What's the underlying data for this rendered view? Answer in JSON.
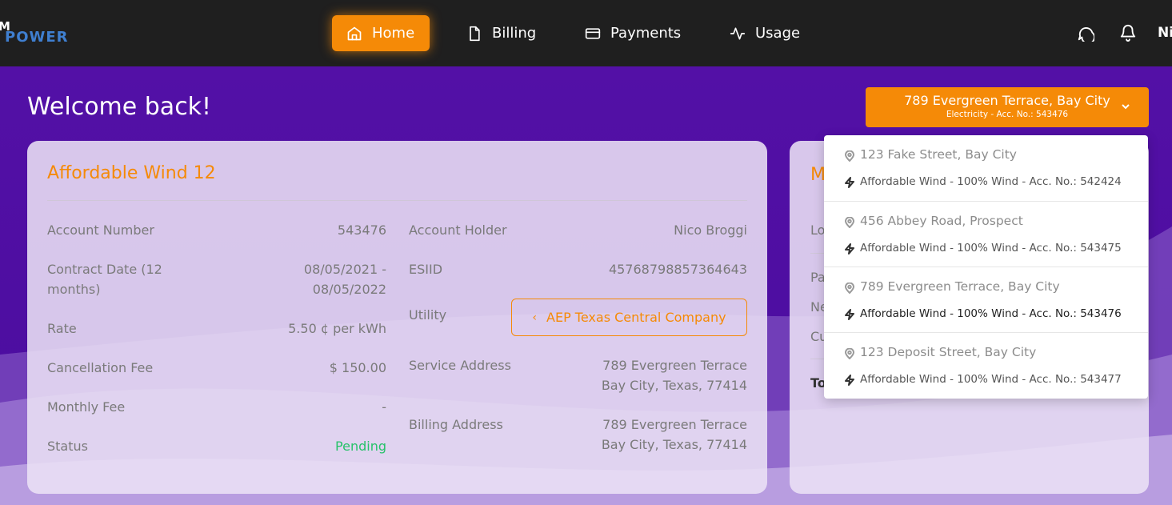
{
  "brand": {
    "mark": "M",
    "name": "POWER"
  },
  "nav": {
    "home": "Home",
    "billing": "Billing",
    "payments": "Payments",
    "usage": "Usage"
  },
  "user": {
    "name": "Ni"
  },
  "welcome": "Welcome back!",
  "account_selector": {
    "address": "789 Evergreen Terrace, Bay City",
    "subtitle": "Electricity - Acc. No.: 543476"
  },
  "plan_card": {
    "title": "Affordable Wind 12",
    "left": {
      "account_number_label": "Account Number",
      "account_number_value": "543476",
      "contract_date_label_1": "Contract Date (12",
      "contract_date_label_2": "months)",
      "contract_date_value_1": "08/05/2021 -",
      "contract_date_value_2": "08/05/2022",
      "rate_label": "Rate",
      "rate_value": "5.50 ¢ per kWh",
      "cancellation_fee_label": "Cancellation Fee",
      "cancellation_fee_value": "$ 150.00",
      "monthly_fee_label": "Monthly Fee",
      "monthly_fee_value": "-",
      "status_label": "Status",
      "status_value": "Pending"
    },
    "right": {
      "account_holder_label": "Account Holder",
      "account_holder_value": "Nico Broggi",
      "esiid_label": "ESIID",
      "esiid_value": "45768798857364643",
      "utility_label": "Utility",
      "utility_value": "AEP Texas Central Company",
      "service_address_label": "Service Address",
      "service_address_line1": "789 Evergreen Terrace",
      "service_address_line2": "Bay City, Texas, 77414",
      "billing_address_label": "Billing Address",
      "billing_address_line1": "789 Evergreen Terrace",
      "billing_address_line2": "Bay City, Texas, 77414"
    }
  },
  "second_card": {
    "title_fragment": "M",
    "row1": "Lo",
    "row2": "Pa",
    "row3": "Ne",
    "row4": "Cu",
    "row5": "To"
  },
  "dropdown": {
    "items": [
      {
        "address": "123 Fake Street, Bay City",
        "plan": "Affordable Wind - 100% Wind - Acc. No.: 542424"
      },
      {
        "address": "456 Abbey Road, Prospect",
        "plan": "Affordable Wind - 100% Wind - Acc. No.: 543475"
      },
      {
        "address": "789 Evergreen Terrace, Bay City",
        "plan": "Affordable Wind - 100% Wind - Acc. No.: 543476"
      },
      {
        "address": "123 Deposit Street, Bay City",
        "plan": "Affordable Wind - 100% Wind - Acc. No.: 543477"
      }
    ]
  },
  "colors": {
    "accent": "#f58a07",
    "topbar": "#1f1f1f",
    "background": "#4a0c9e",
    "status_pending": "#27c26a"
  }
}
